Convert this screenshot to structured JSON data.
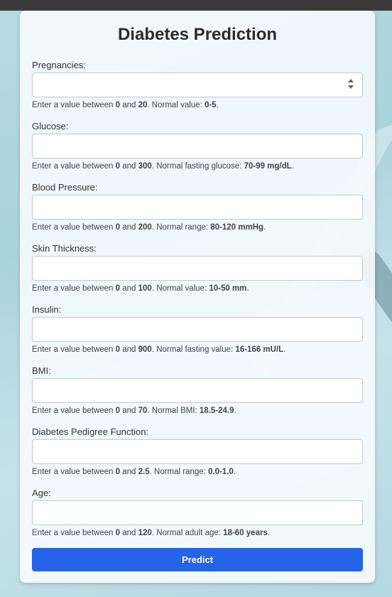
{
  "form": {
    "title": "Diabetes Prediction",
    "submit_label": "Predict",
    "fields": [
      {
        "label": "Pregnancies:",
        "value": "",
        "hint_prefix": "Enter a value between ",
        "min": "0",
        "and": " and ",
        "max": "20",
        "hint_mid": ". Normal value: ",
        "normal": "0-5",
        "hint_end": "."
      },
      {
        "label": "Glucose:",
        "value": "",
        "hint_prefix": "Enter a value between ",
        "min": "0",
        "and": " and ",
        "max": "300",
        "hint_mid": ". Normal fasting glucose: ",
        "normal": "70-99 mg/dL",
        "hint_end": "."
      },
      {
        "label": "Blood Pressure:",
        "value": "",
        "hint_prefix": "Enter a value between ",
        "min": "0",
        "and": " and ",
        "max": "200",
        "hint_mid": ". Normal range: ",
        "normal": "80-120 mmHg",
        "hint_end": "."
      },
      {
        "label": "Skin Thickness:",
        "value": "",
        "hint_prefix": "Enter a value between ",
        "min": "0",
        "and": " and ",
        "max": "100",
        "hint_mid": ". Normal value: ",
        "normal": "10-50 mm",
        "hint_end": "."
      },
      {
        "label": "Insulin:",
        "value": "",
        "hint_prefix": "Enter a value between ",
        "min": "0",
        "and": " and ",
        "max": "900",
        "hint_mid": ". Normal fasting value: ",
        "normal": "16-166 mU/L",
        "hint_end": "."
      },
      {
        "label": "BMI:",
        "value": "",
        "hint_prefix": "Enter a value between ",
        "min": "0",
        "and": " and ",
        "max": "70",
        "hint_mid": ". Normal BMI: ",
        "normal": "18.5-24.9",
        "hint_end": "."
      },
      {
        "label": "Diabetes Pedigree Function:",
        "value": "",
        "hint_prefix": "Enter a value between ",
        "min": "0",
        "and": " and ",
        "max": "2.5",
        "hint_mid": ". Normal range: ",
        "normal": "0.0-1.0",
        "hint_end": "."
      },
      {
        "label": "Age:",
        "value": "",
        "hint_prefix": "Enter a value between ",
        "min": "0",
        "and": " and ",
        "max": "120",
        "hint_mid": ". Normal adult age: ",
        "normal": "18-60 years",
        "hint_end": "."
      }
    ]
  },
  "colors": {
    "button": "#2563e8",
    "topbar": "#3a3a3a"
  }
}
